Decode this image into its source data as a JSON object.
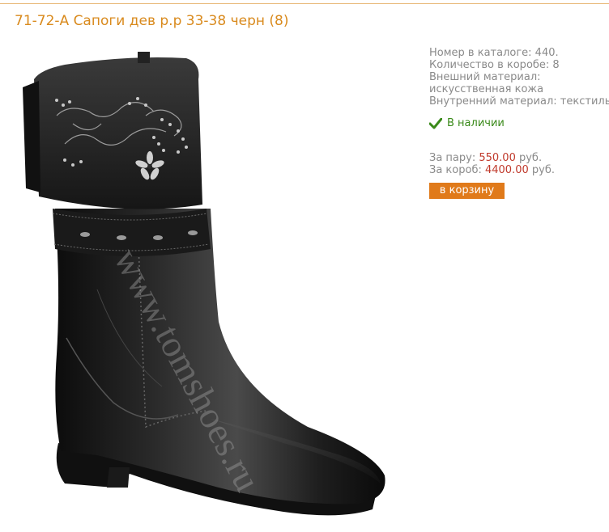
{
  "product": {
    "title": "71-72-А Сапоги дев р.р 33-38 черн (8)",
    "watermark": "www.tomshoes.ru",
    "catalog_number": "Номер в каталоге: 440.",
    "box_quantity": "Количество в коробе: 8",
    "outer_material_label": "Внешний материал:",
    "outer_material_value": "искусственная кожа",
    "inner_material": "Внутренний материал: текстиль",
    "stock_status": "В наличии",
    "price_pair_label": "За пару: ",
    "price_pair_value": "550.00",
    "price_box_label": "За короб: ",
    "price_box_value": "4400.00",
    "currency": " руб.",
    "cart_button": "в корзину"
  },
  "colors": {
    "title": "#d98a1d",
    "text": "#8a8a8a",
    "price": "#c0392b",
    "stock": "#3a8a1a",
    "button": "#e07a1a"
  },
  "icons": [
    "checkmark-icon"
  ]
}
